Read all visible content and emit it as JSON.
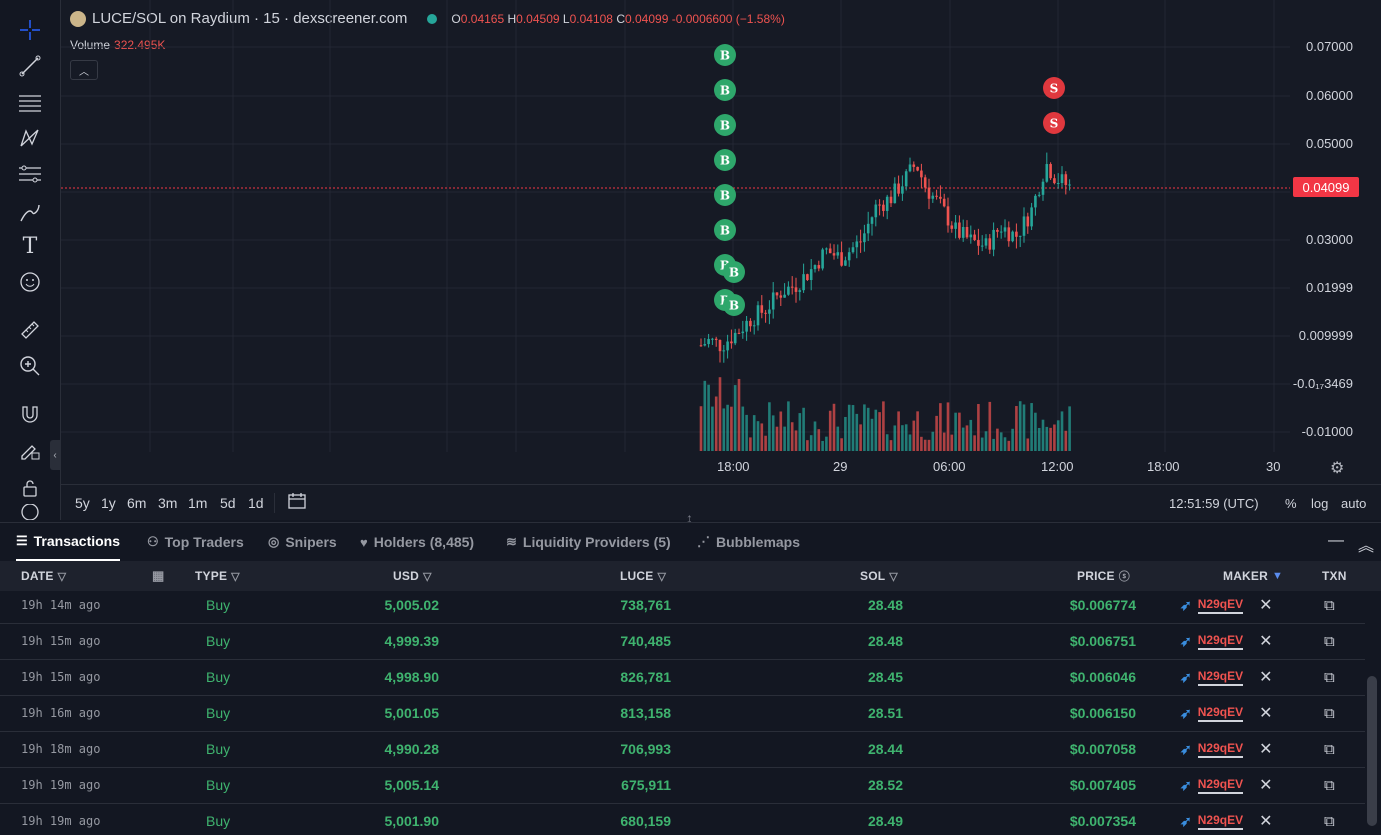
{
  "chart": {
    "title": "LUCE/SOL on Raydium · 15 · dexscreener.com",
    "ohlc": {
      "o_label": "O",
      "o": "0.04165",
      "h_label": "H",
      "h": "0.04509",
      "l_label": "L",
      "l": "0.04108",
      "c_label": "C",
      "c": "0.04099",
      "change": "-0.0006600 (−1.58%)"
    },
    "volume_label": "Volume",
    "volume_value": "322.495K",
    "y_ticks": [
      "0.07000",
      "0.06000",
      "0.05000",
      "0.04099",
      "0.03000",
      "0.01999",
      "0.009999",
      "-0.0₁₇3469",
      "-0.01000"
    ],
    "price_tag": "0.04099",
    "x_ticks": [
      "18:00",
      "29",
      "06:00",
      "12:00",
      "18:00",
      "30"
    ],
    "timeframes": [
      "5y",
      "1y",
      "6m",
      "3m",
      "1m",
      "5d",
      "1d"
    ],
    "clock": "12:51:59 (UTC)",
    "right_buttons": [
      "%",
      "log",
      "auto"
    ],
    "buy_marker": "B",
    "sell_marker": "S",
    "colors": {
      "up": "#26a69a",
      "down": "#ef5350",
      "buy_marker": "#2ea76b",
      "sell_marker": "#e0383e"
    }
  },
  "toolbar": {
    "icons": [
      "crosshair-icon",
      "trend-line-icon",
      "horizontal-lines-icon",
      "pattern-icon",
      "fib-icon",
      "brush-icon",
      "text-icon",
      "emoji-icon",
      "ruler-icon",
      "zoom-in-icon",
      "magnet-icon",
      "lock-pencil-icon",
      "lock-icon",
      "eye-icon"
    ]
  },
  "tabs": [
    {
      "label": "Transactions",
      "icon": "☰"
    },
    {
      "label": "Top Traders",
      "icon": "⚇"
    },
    {
      "label": "Snipers",
      "icon": "◎"
    },
    {
      "label": "Holders (8,485)",
      "icon": "♥"
    },
    {
      "label": "Liquidity Providers (5)",
      "icon": "≋"
    },
    {
      "label": "Bubblemaps",
      "icon": "⋰"
    }
  ],
  "table": {
    "headers": {
      "date": "DATE",
      "type": "TYPE",
      "usd": "USD",
      "luce": "LUCE",
      "sol": "SOL",
      "price": "PRICE",
      "maker": "MAKER",
      "txn": "TXN"
    },
    "rows": [
      {
        "date": "19h 14m ago",
        "type": "Buy",
        "usd": "5,005.02",
        "luce": "738,761",
        "sol": "28.48",
        "price": "$0.006774",
        "maker": "N29qEV"
      },
      {
        "date": "19h 15m ago",
        "type": "Buy",
        "usd": "4,999.39",
        "luce": "740,485",
        "sol": "28.48",
        "price": "$0.006751",
        "maker": "N29qEV"
      },
      {
        "date": "19h 15m ago",
        "type": "Buy",
        "usd": "4,998.90",
        "luce": "826,781",
        "sol": "28.45",
        "price": "$0.006046",
        "maker": "N29qEV"
      },
      {
        "date": "19h 16m ago",
        "type": "Buy",
        "usd": "5,001.05",
        "luce": "813,158",
        "sol": "28.51",
        "price": "$0.006150",
        "maker": "N29qEV"
      },
      {
        "date": "19h 18m ago",
        "type": "Buy",
        "usd": "4,990.28",
        "luce": "706,993",
        "sol": "28.44",
        "price": "$0.007058",
        "maker": "N29qEV"
      },
      {
        "date": "19h 19m ago",
        "type": "Buy",
        "usd": "5,005.14",
        "luce": "675,911",
        "sol": "28.52",
        "price": "$0.007405",
        "maker": "N29qEV"
      },
      {
        "date": "19h 19m ago",
        "type": "Buy",
        "usd": "5,001.90",
        "luce": "680,159",
        "sol": "28.49",
        "price": "$0.007354",
        "maker": "N29qEV"
      }
    ]
  }
}
